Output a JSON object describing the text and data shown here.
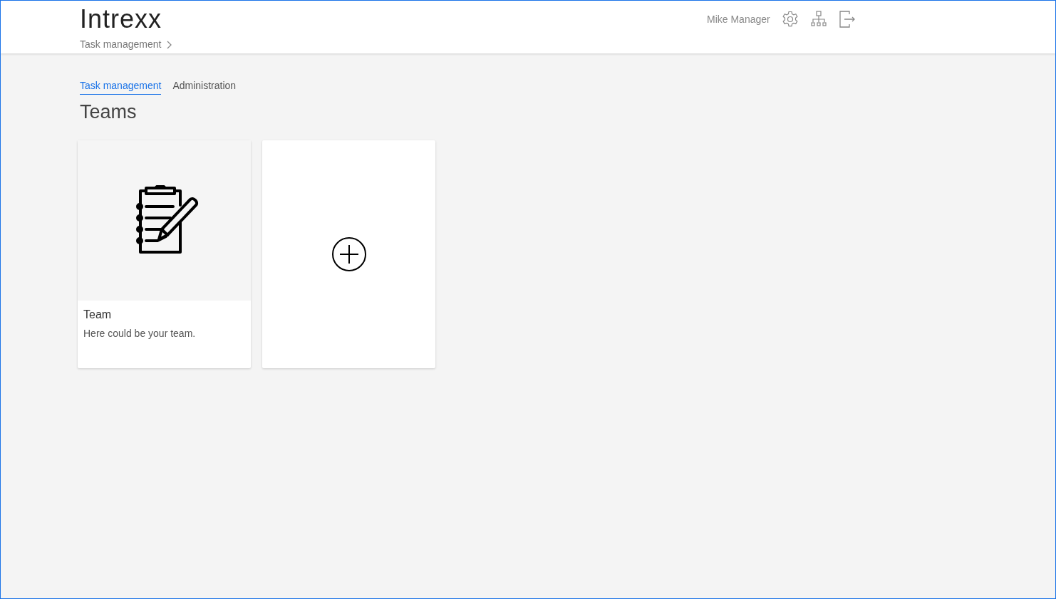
{
  "header": {
    "logo": "Intrexx",
    "breadcrumb": "Task management",
    "user": "Mike Manager"
  },
  "tabs": [
    {
      "label": "Task management",
      "selected": true
    },
    {
      "label": "Administration",
      "selected": false
    }
  ],
  "page_title": "Teams",
  "cards": [
    {
      "kind": "team",
      "title": "Team",
      "description": "Here could be your team."
    },
    {
      "kind": "add"
    }
  ]
}
